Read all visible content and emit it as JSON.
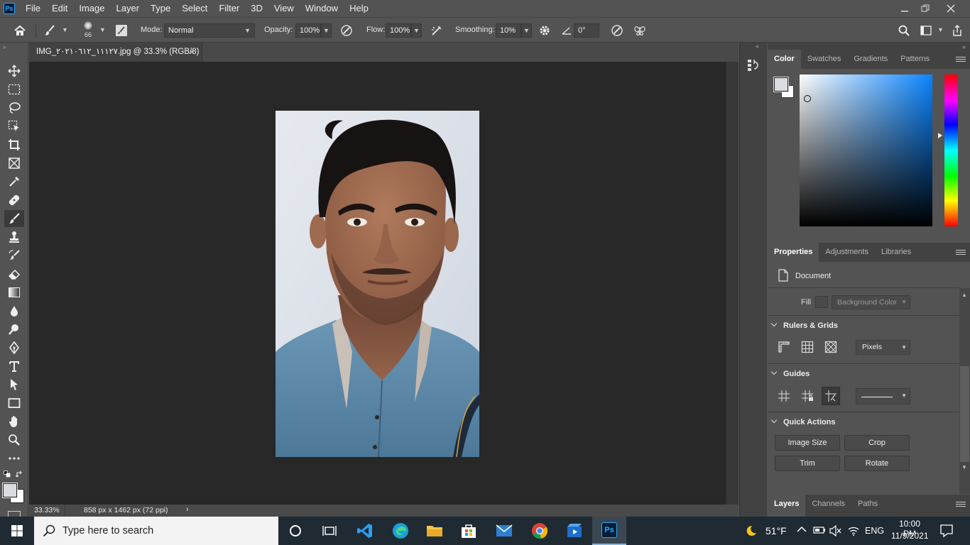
{
  "app": {
    "logo": "Ps",
    "title": "Adobe Photoshop"
  },
  "menu": [
    "File",
    "Edit",
    "Image",
    "Layer",
    "Type",
    "Select",
    "Filter",
    "3D",
    "View",
    "Window",
    "Help"
  ],
  "options": {
    "brush_size": "66",
    "mode_label": "Mode:",
    "mode_value": "Normal",
    "opacity_label": "Opacity:",
    "opacity_value": "100%",
    "flow_label": "Flow:",
    "flow_value": "100%",
    "smoothing_label": "Smoothing:",
    "smoothing_value": "10%",
    "angle_value": "0°"
  },
  "document": {
    "tab_title": "IMG_١١١٢٧_٢٠٢١٠٦١٢.jpg @ 33.3% (RGB/8) *",
    "zoom": "33.33%",
    "info": "858 px x 1462 px (72 ppi)"
  },
  "color_panel": {
    "tabs": [
      "Color",
      "Swatches",
      "Gradients",
      "Patterns"
    ],
    "active_tab": 0,
    "foreground": "#d9dce0",
    "background": "#ffffff",
    "hue_color": "#0a84ff"
  },
  "properties_panel": {
    "tabs": [
      "Properties",
      "Adjustments",
      "Libraries"
    ],
    "active_tab": 0,
    "doc_label": "Document",
    "fill_label": "Fill",
    "fill_value": "Background Color",
    "rulers_title": "Rulers & Grids",
    "units_value": "Pixels",
    "guides_title": "Guides",
    "quick_actions_title": "Quick Actions",
    "actions": [
      "Image Size",
      "Crop",
      "Trim",
      "Rotate"
    ]
  },
  "layers_panel": {
    "tabs": [
      "Layers",
      "Channels",
      "Paths"
    ],
    "active_tab": 0
  },
  "taskbar": {
    "search_placeholder": "Type here to search",
    "weather": "51°F",
    "language": "ENG",
    "time": "10:00 PM",
    "date": "11/9/2021"
  }
}
